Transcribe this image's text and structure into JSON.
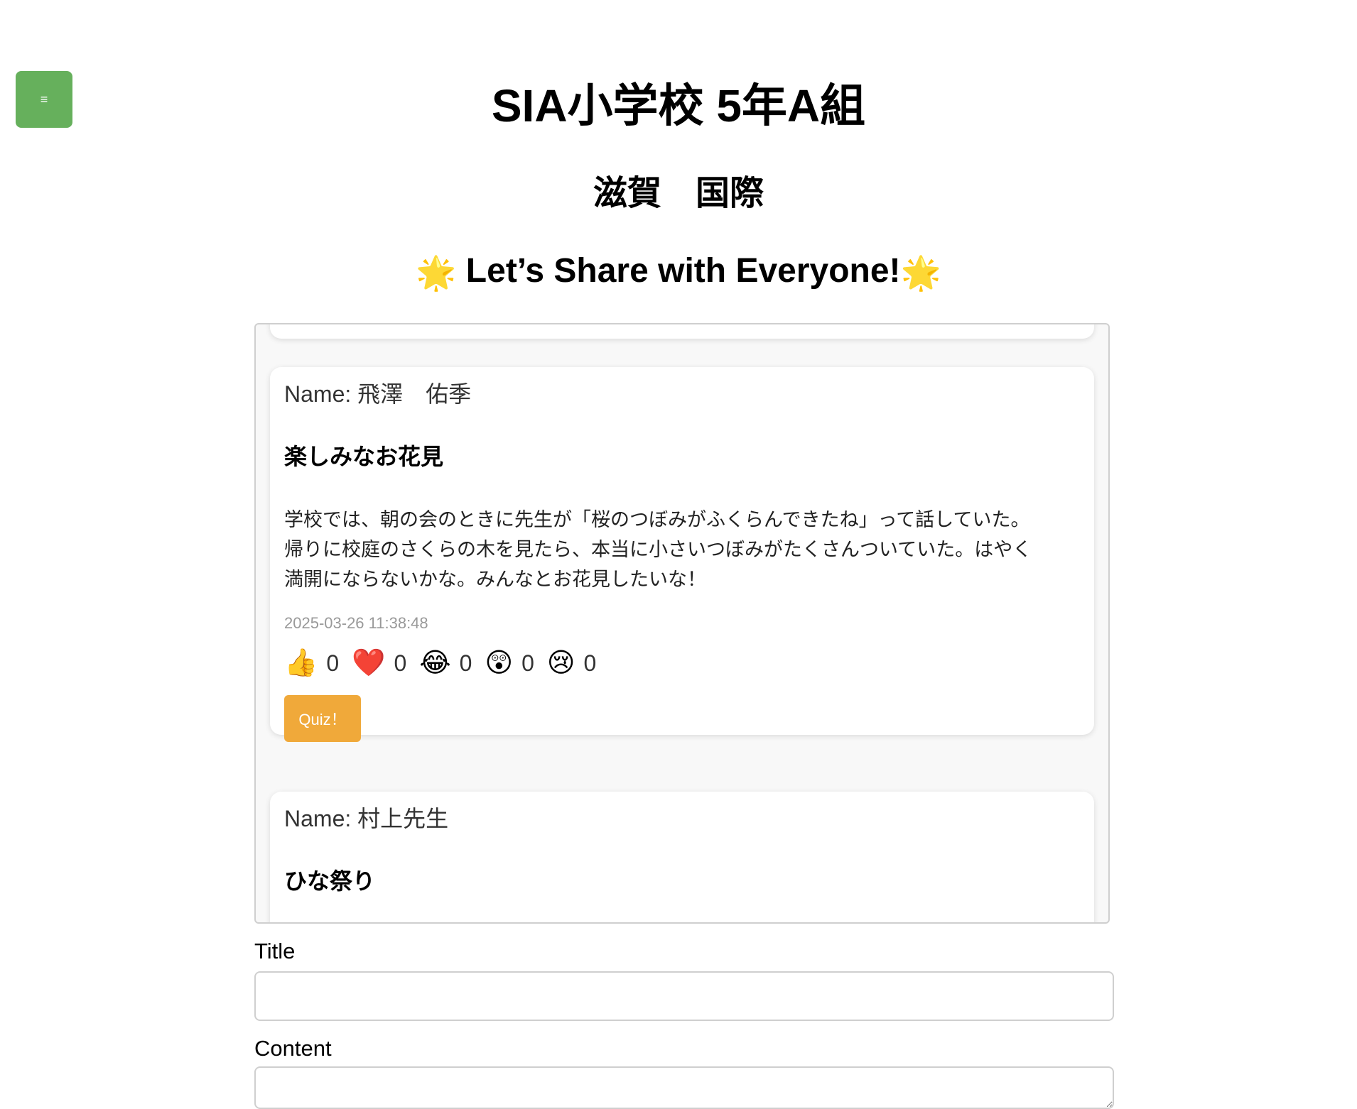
{
  "menu": {
    "icon_label": "≡",
    "icon": "hamburger-menu-icon",
    "color": "#66b05c"
  },
  "header": {
    "title": "SIA小学校 5年A組",
    "class_name": "滋賀　国際",
    "banner_text": "Let’s Share with Everyone!",
    "banner_icon": "glowing-star-icon",
    "banner_star": "🌟"
  },
  "posts": [
    {
      "name": "Name: 飛澤　佑季",
      "title": "楽しみなお花見",
      "body": "学校では、朝の会のときに先生が「桜のつぼみがふくらんできたね」って話していた。\n帰りに校庭のさくらの木を見たら、本当に小さいつぼみがたくさんついていた。はやく\n満開にならないかな。みんなとお花見したいな！",
      "timestamp": "2025-03-26 11:38:48",
      "reactions": [
        {
          "icon": "thumbs-up-icon",
          "emoji": "👍",
          "count": "0"
        },
        {
          "icon": "heart-icon",
          "emoji": "❤️",
          "count": "0"
        },
        {
          "icon": "laughing-face-icon",
          "emoji": "😂",
          "count": "0"
        },
        {
          "icon": "surprised-face-icon",
          "emoji": "😲",
          "count": "0"
        },
        {
          "icon": "crying-face-icon",
          "emoji": "😢",
          "count": "0"
        }
      ],
      "quiz_label": "Quiz！",
      "quiz_color": "#f0a93a"
    },
    {
      "name": "Name: 村上先生",
      "title": "ひな祭り"
    }
  ],
  "form": {
    "title_label": "Title",
    "title_value": "",
    "content_label": "Content",
    "content_value": ""
  }
}
